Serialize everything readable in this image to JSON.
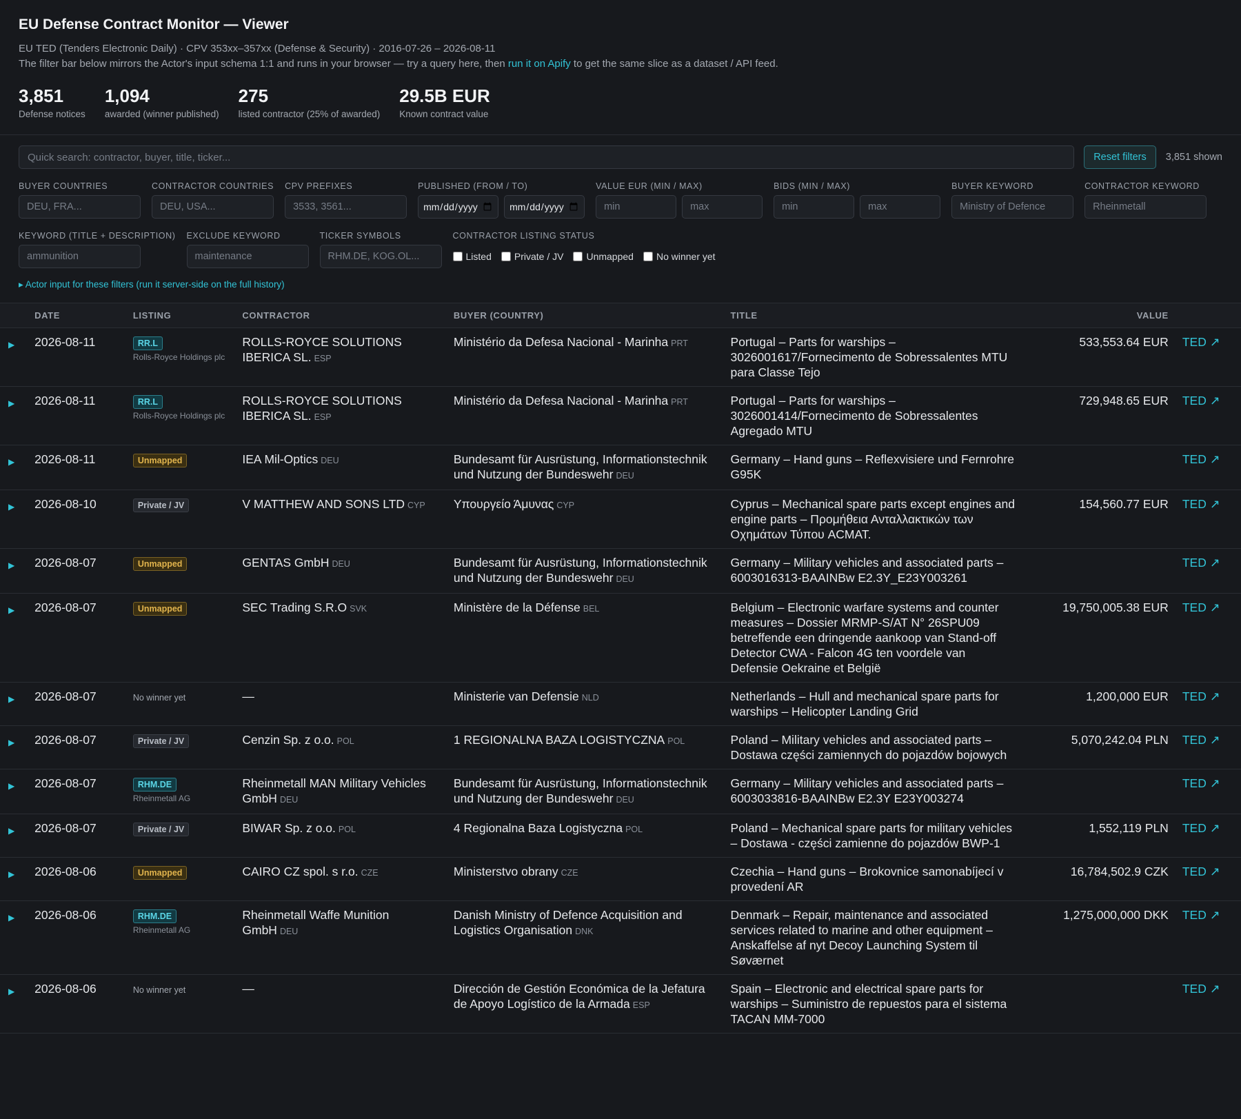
{
  "header": {
    "title": "EU Defense Contract Monitor — Viewer",
    "source_line": "EU TED (Tenders Electronic Daily) · CPV 353xx–357xx (Defense & Security) · 2016-07-26 – 2026-08-11",
    "desc_before": "The filter bar below mirrors the Actor's input schema 1:1 and runs in your browser — try a query here, then ",
    "desc_link": "run it on Apify",
    "desc_after": " to get the same slice as a dataset / API feed."
  },
  "stats": [
    {
      "num": "3,851",
      "label": "Defense notices"
    },
    {
      "num": "1,094",
      "label": "awarded (winner published)"
    },
    {
      "num": "275",
      "label": "listed contractor (25% of awarded)"
    },
    {
      "num": "29.5B EUR",
      "label": "Known contract value"
    }
  ],
  "filters": {
    "search_placeholder": "Quick search: contractor, buyer, title, ticker...",
    "reset_label": "Reset filters",
    "shown": "3,851 shown",
    "buyer_countries": {
      "label": "BUYER COUNTRIES",
      "placeholder": "DEU, FRA..."
    },
    "contractor_countries": {
      "label": "CONTRACTOR COUNTRIES",
      "placeholder": "DEU, USA..."
    },
    "cpv_prefixes": {
      "label": "CPV PREFIXES",
      "placeholder": "3533, 3561..."
    },
    "published": {
      "label": "PUBLISHED (FROM / TO)"
    },
    "value": {
      "label": "VALUE EUR (MIN / MAX)",
      "min": "min",
      "max": "max"
    },
    "bids": {
      "label": "BIDS (MIN / MAX)",
      "min": "min",
      "max": "max"
    },
    "buyer_keyword": {
      "label": "BUYER KEYWORD",
      "placeholder": "Ministry of Defence"
    },
    "contractor_keyword": {
      "label": "CONTRACTOR KEYWORD",
      "placeholder": "Rheinmetall"
    },
    "keyword": {
      "label": "KEYWORD (TITLE + DESCRIPTION)",
      "placeholder": "ammunition"
    },
    "exclude": {
      "label": "EXCLUDE KEYWORD",
      "placeholder": "maintenance"
    },
    "tickers": {
      "label": "TICKER SYMBOLS",
      "placeholder": "RHM.DE, KOG.OL..."
    },
    "listing_status": {
      "label": "CONTRACTOR LISTING STATUS",
      "options": [
        "Listed",
        "Private / JV",
        "Unmapped",
        "No winner yet"
      ]
    },
    "actor_link": "▸ Actor input for these filters (run it server-side on the full history)"
  },
  "table": {
    "headers": {
      "date": "DATE",
      "listing": "LISTING",
      "contractor": "CONTRACTOR",
      "buyer": "BUYER (COUNTRY)",
      "title": "TITLE",
      "value": "VALUE"
    },
    "link_label": "TED ↗",
    "rows": [
      {
        "date": "2026-08-11",
        "listing": {
          "kind": "ticker",
          "text": "RR.L",
          "parent": "Rolls-Royce Holdings plc"
        },
        "contractor": "ROLLS-ROYCE SOLUTIONS IBERICA SL.",
        "contractor_cc": "ESP",
        "buyer": "Ministério da Defesa Nacional - Marinha",
        "buyer_cc": "PRT",
        "title": "Portugal – Parts for warships – 3026001617/Fornecimento de Sobressalentes MTU para Classe Tejo",
        "value": "533,553.64 EUR"
      },
      {
        "date": "2026-08-11",
        "listing": {
          "kind": "ticker",
          "text": "RR.L",
          "parent": "Rolls-Royce Holdings plc"
        },
        "contractor": "ROLLS-ROYCE SOLUTIONS IBERICA SL.",
        "contractor_cc": "ESP",
        "buyer": "Ministério da Defesa Nacional - Marinha",
        "buyer_cc": "PRT",
        "title": "Portugal – Parts for warships – 3026001414/Fornecimento de Sobressalentes Agregado MTU",
        "value": "729,948.65 EUR"
      },
      {
        "date": "2026-08-11",
        "listing": {
          "kind": "unmapped",
          "text": "Unmapped"
        },
        "contractor": "IEA Mil-Optics",
        "contractor_cc": "DEU",
        "buyer": "Bundesamt für Ausrüstung, Informationstechnik und Nutzung der Bundeswehr",
        "buyer_cc": "DEU",
        "title": "Germany – Hand guns – Reflexvisiere und Fernrohre G95K",
        "value": ""
      },
      {
        "date": "2026-08-10",
        "listing": {
          "kind": "private",
          "text": "Private / JV"
        },
        "contractor": "V MATTHEW AND SONS LTD",
        "contractor_cc": "CYP",
        "buyer": "Υπουργείο Άμυνας",
        "buyer_cc": "CYP",
        "title": "Cyprus – Mechanical spare parts except engines and engine parts – Προμήθεια Ανταλλακτικών των Οχημάτων Τύπου ACMAT.",
        "value": "154,560.77 EUR"
      },
      {
        "date": "2026-08-07",
        "listing": {
          "kind": "unmapped",
          "text": "Unmapped"
        },
        "contractor": "GENTAS GmbH",
        "contractor_cc": "DEU",
        "buyer": "Bundesamt für Ausrüstung, Informationstechnik und Nutzung der Bundeswehr",
        "buyer_cc": "DEU",
        "title": "Germany – Military vehicles and associated parts – 6003016313-BAAINBw E2.3Y_E23Y003261",
        "value": ""
      },
      {
        "date": "2026-08-07",
        "listing": {
          "kind": "unmapped",
          "text": "Unmapped"
        },
        "contractor": "SEC Trading S.R.O",
        "contractor_cc": "SVK",
        "buyer": "Ministère de la Défense",
        "buyer_cc": "BEL",
        "title": "Belgium – Electronic warfare systems and counter measures – Dossier MRMP-S/AT N° 26SPU09 betreffende een dringende aankoop van Stand-off Detector CWA - Falcon 4G ten voordele van Defensie Oekraine et België",
        "value": "19,750,005.38 EUR"
      },
      {
        "date": "2026-08-07",
        "listing": {
          "kind": "nowinner",
          "text": "No winner yet"
        },
        "contractor": "—",
        "contractor_cc": "",
        "buyer": "Ministerie van Defensie",
        "buyer_cc": "NLD",
        "title": "Netherlands – Hull and mechanical spare parts for warships – Helicopter Landing Grid",
        "value": "1,200,000 EUR"
      },
      {
        "date": "2026-08-07",
        "listing": {
          "kind": "private",
          "text": "Private / JV"
        },
        "contractor": "Cenzin Sp. z o.o.",
        "contractor_cc": "POL",
        "buyer": "1 REGIONALNA BAZA LOGISTYCZNA",
        "buyer_cc": "POL",
        "title": "Poland – Military vehicles and associated parts – Dostawa części zamiennych do pojazdów bojowych",
        "value": "5,070,242.04 PLN"
      },
      {
        "date": "2026-08-07",
        "listing": {
          "kind": "ticker",
          "text": "RHM.DE",
          "parent": "Rheinmetall AG"
        },
        "contractor": "Rheinmetall MAN Military Vehicles GmbH",
        "contractor_cc": "DEU",
        "buyer": "Bundesamt für Ausrüstung, Informationstechnik und Nutzung der Bundeswehr",
        "buyer_cc": "DEU",
        "title": "Germany – Military vehicles and associated parts – 6003033816-BAAINBw E2.3Y E23Y003274",
        "value": ""
      },
      {
        "date": "2026-08-07",
        "listing": {
          "kind": "private",
          "text": "Private / JV"
        },
        "contractor": "BIWAR Sp. z o.o.",
        "contractor_cc": "POL",
        "buyer": "4 Regionalna Baza Logistyczna",
        "buyer_cc": "POL",
        "title": "Poland – Mechanical spare parts for military vehicles – Dostawa - części zamienne do pojazdów BWP-1",
        "value": "1,552,119 PLN"
      },
      {
        "date": "2026-08-06",
        "listing": {
          "kind": "unmapped",
          "text": "Unmapped"
        },
        "contractor": "CAIRO CZ spol. s r.o.",
        "contractor_cc": "CZE",
        "buyer": "Ministerstvo obrany",
        "buyer_cc": "CZE",
        "title": "Czechia – Hand guns – Brokovnice samonabíjecí v provedení AR",
        "value": "16,784,502.9 CZK"
      },
      {
        "date": "2026-08-06",
        "listing": {
          "kind": "ticker",
          "text": "RHM.DE",
          "parent": "Rheinmetall AG"
        },
        "contractor": "Rheinmetall Waffe Munition GmbH",
        "contractor_cc": "DEU",
        "buyer": "Danish Ministry of Defence Acquisition and Logistics Organisation",
        "buyer_cc": "DNK",
        "title": "Denmark – Repair, maintenance and associated services related to marine and other equipment – Anskaffelse af nyt Decoy Launching System til Søværnet",
        "value": "1,275,000,000 DKK"
      },
      {
        "date": "2026-08-06",
        "listing": {
          "kind": "nowinner",
          "text": "No winner yet"
        },
        "contractor": "—",
        "contractor_cc": "",
        "buyer": "Dirección de Gestión Económica de la Jefatura de Apoyo Logístico de la Armada",
        "buyer_cc": "ESP",
        "title": "Spain – Electronic and electrical spare parts for warships – Suministro de repuestos para el sistema TACAN MM-7000",
        "value": ""
      }
    ]
  }
}
